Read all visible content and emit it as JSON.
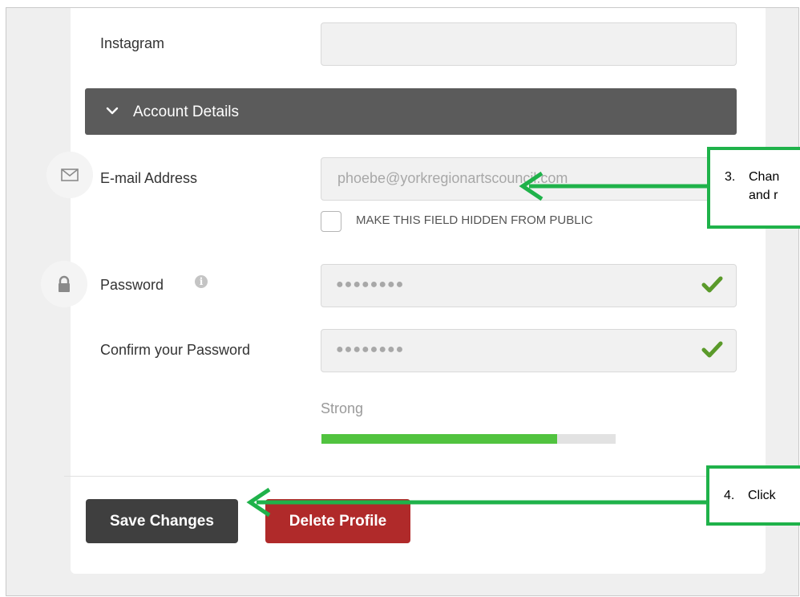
{
  "form": {
    "instagram_label": "Instagram",
    "instagram_value": "",
    "section_title": "Account Details",
    "email_label": "E-mail Address",
    "email_value": "phoebe@yorkregionartscouncil.com",
    "hide_checkbox_label": "MAKE THIS FIELD HIDDEN FROM PUBLIC",
    "hide_checkbox_checked": false,
    "password_label": "Password",
    "password_value": "●●●●●●●●",
    "confirm_label": "Confirm your Password",
    "confirm_value": "●●●●●●●●",
    "strength_label": "Strong",
    "strength_fraction": 0.8,
    "save_button": "Save Changes",
    "delete_button": "Delete Profile"
  },
  "callouts": [
    {
      "number": "3.",
      "lines": [
        "Chan",
        "and r"
      ]
    },
    {
      "number": "4.",
      "lines": [
        "Click"
      ]
    }
  ],
  "icons": {
    "section_toggle": "chevron-down-icon",
    "email": "envelope-icon",
    "password": "lock-icon",
    "info": "info-icon",
    "valid": "checkmark-icon"
  },
  "colors": {
    "accent_green": "#1fb24a",
    "strength_fill": "#51c33f",
    "check_green": "#5a9a2a",
    "header_bg": "#5b5b5b",
    "save_bg": "#3f3f3f",
    "delete_bg": "#b02a2a"
  }
}
